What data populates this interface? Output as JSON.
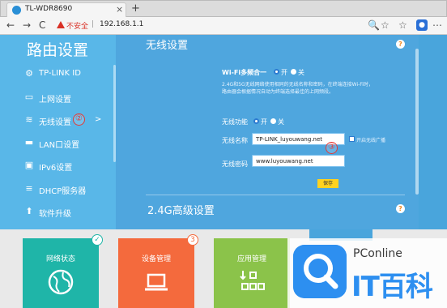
{
  "browser": {
    "tab_title": "TL-WDR8690",
    "tab_close": "×",
    "new_tab": "+",
    "back": "←",
    "forward": "→",
    "reload": "C",
    "not_secure": "不安全",
    "separator": "|",
    "url": "192.168.1.1",
    "profile": "👤"
  },
  "sidebar": {
    "title": "路由设置",
    "items": [
      {
        "icon": "gear-icon",
        "glyph": "⚙",
        "label": "TP-LINK ID"
      },
      {
        "icon": "monitor-icon",
        "glyph": "▭",
        "label": "上网设置"
      },
      {
        "icon": "wifi-icon",
        "glyph": "≋",
        "label": "无线设置",
        "chevron": ">"
      },
      {
        "icon": "lan-icon",
        "glyph": "▬",
        "label": "LAN口设置"
      },
      {
        "icon": "ipv6-icon",
        "glyph": "▣",
        "label": "IPv6设置"
      },
      {
        "icon": "dhcp-icon",
        "glyph": "≡",
        "label": "DHCP服务器"
      },
      {
        "icon": "upgrade-icon",
        "glyph": "⬆",
        "label": "软件升级"
      }
    ]
  },
  "main": {
    "title": "无线设置",
    "help": "?",
    "wifi_merge": {
      "label": "Wi-Fi多频合一",
      "on": "开",
      "off": "关",
      "desc_line1": "2.4G和5G无线网络使用相同的无线名称和密码，在终端连接Wi-Fi时，",
      "desc_line2": "路由器会根据情况自动为终端选择最佳的上网频段。"
    },
    "wireless_func": {
      "label": "无线功能",
      "on": "开",
      "off": "关"
    },
    "ssid": {
      "label": "无线名称",
      "value": "TP-LINK_luyouwang.net",
      "broadcast": "开启无线广播"
    },
    "password": {
      "label": "无线密码",
      "value": "www.luyouwang.net"
    },
    "save": "保存",
    "advanced_title": "2.4G高级设置"
  },
  "annotations": {
    "two": "②",
    "three": "③"
  },
  "tiles": [
    {
      "label": "网络状态",
      "color": "#1fb5a8",
      "badge": "✓"
    },
    {
      "label": "设备管理",
      "color": "#f46a3d",
      "badge": "3"
    },
    {
      "label": "应用管理",
      "color": "#8bc34a",
      "badge": ""
    }
  ],
  "watermark": {
    "pconline": "PConline",
    "brand": "IT百科"
  }
}
